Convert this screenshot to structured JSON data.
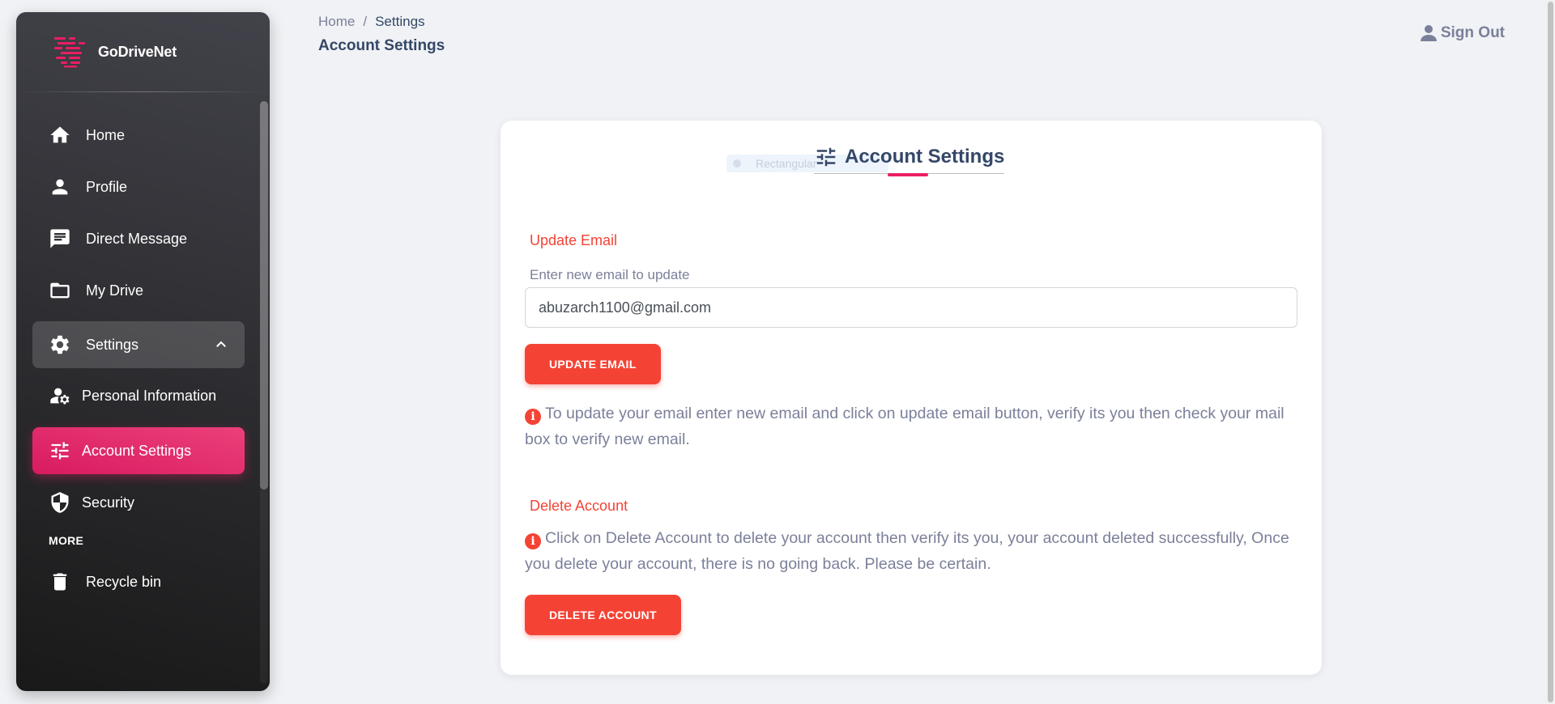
{
  "brand": {
    "name": "GoDriveNet"
  },
  "sidebar": {
    "items": [
      {
        "label": "Home",
        "icon": "home-icon"
      },
      {
        "label": "Profile",
        "icon": "person-icon"
      },
      {
        "label": "Direct Message",
        "icon": "message-icon"
      },
      {
        "label": "My Drive",
        "icon": "folder-icon"
      },
      {
        "label": "Settings",
        "icon": "gear-icon",
        "expanded": true
      },
      {
        "label": "Personal Information",
        "icon": "manage-accounts-icon"
      },
      {
        "label": "Account Settings",
        "icon": "tune-icon",
        "active": true
      },
      {
        "label": "Security",
        "icon": "shield-icon"
      }
    ],
    "more_label": "MORE",
    "more_items": [
      {
        "label": "Recycle bin",
        "icon": "trash-icon"
      }
    ]
  },
  "header": {
    "breadcrumb": {
      "home": "Home",
      "separator": "/",
      "current": "Settings"
    },
    "title": "Account Settings",
    "sign_out": "Sign Out"
  },
  "card": {
    "title": "Account Settings",
    "ghost_chip": "Rectangular",
    "update_email": {
      "section_title": "Update Email",
      "field_label": "Enter new email to update",
      "email_value": "abuzarch1100@gmail.com",
      "button": "UPDATE EMAIL",
      "info": "To update your email enter new email and click on update email button, verify its you then check your mail box to verify new email."
    },
    "delete_account": {
      "section_title": "Delete Account",
      "info": "Click on Delete Account to delete your account then verify its you, your account deleted successfully, Once you delete your account, there is no going back. Please be certain.",
      "button": "DELETE ACCOUNT"
    }
  },
  "colors": {
    "accent": "#e91e63",
    "danger": "#f44335",
    "text_dark": "#344767",
    "text_muted": "#7b809a"
  }
}
